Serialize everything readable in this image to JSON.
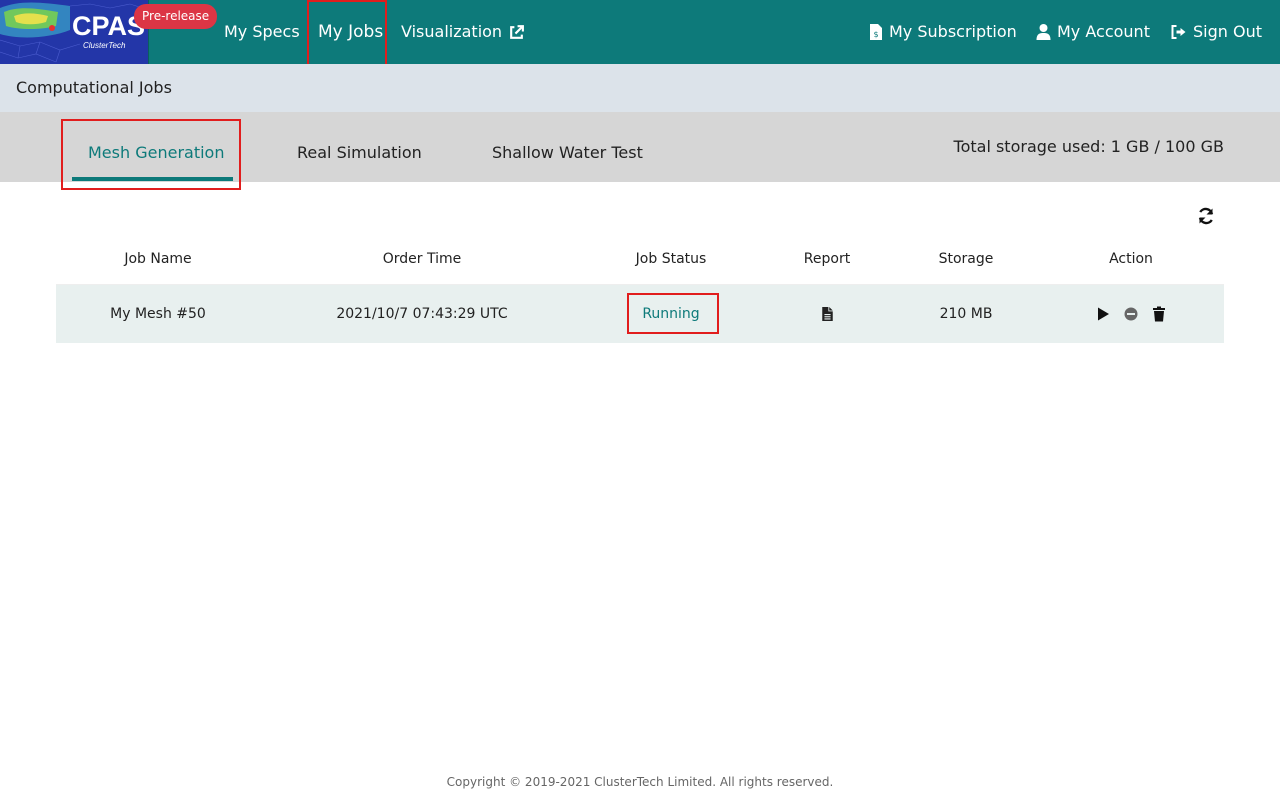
{
  "brand": {
    "title": "CPAS",
    "subtitle": "ClusterTech",
    "badge": "Pre-release"
  },
  "nav": {
    "my_specs": "My Specs",
    "my_jobs": "My Jobs",
    "visualization": "Visualization",
    "my_subscription": "My Subscription",
    "my_account": "My Account",
    "sign_out": "Sign Out"
  },
  "breadcrumb": "Computational Jobs",
  "tabs": [
    {
      "label": "Mesh Generation",
      "active": true
    },
    {
      "label": "Real Simulation",
      "active": false
    },
    {
      "label": "Shallow Water Test",
      "active": false
    }
  ],
  "storage_total": "Total storage used: 1 GB / 100 GB",
  "table": {
    "headers": [
      "Job Name",
      "Order Time",
      "Job Status",
      "Report",
      "Storage",
      "Action"
    ],
    "rows": [
      {
        "job_name": "My Mesh #50",
        "order_time": "2021/10/7 07:43:29 UTC",
        "status": "Running",
        "storage": "210 MB"
      }
    ]
  },
  "icons": {
    "refresh": "refresh-icon",
    "report": "file-icon",
    "actions": [
      "play-icon",
      "stop-icon",
      "trash-icon"
    ]
  },
  "colors": {
    "primary": "#0d7a7a",
    "badge": "#dc3545",
    "highlight": "#e11d1d"
  },
  "footer": "Copyright © 2019-2021 ClusterTech Limited. All rights reserved."
}
